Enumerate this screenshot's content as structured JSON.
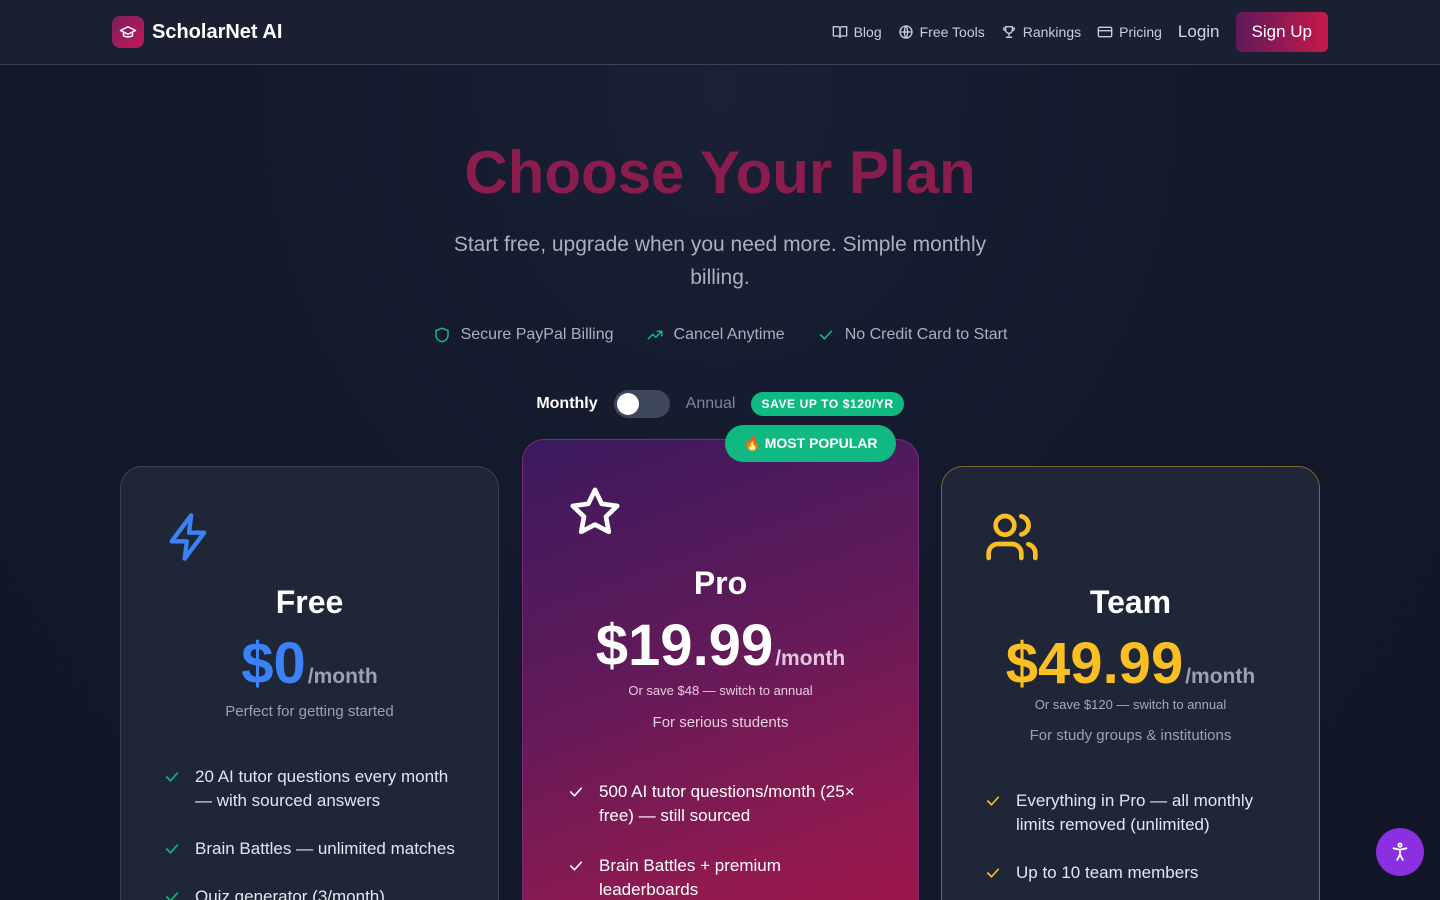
{
  "brand": {
    "name": "ScholarNet AI"
  },
  "nav": {
    "items": [
      {
        "label": "Blog",
        "icon": "book-icon"
      },
      {
        "label": "Free Tools",
        "icon": "globe-icon"
      },
      {
        "label": "Rankings",
        "icon": "trophy-icon"
      },
      {
        "label": "Pricing",
        "icon": "credit-card-icon"
      }
    ],
    "login": "Login",
    "signup": "Sign Up"
  },
  "hero": {
    "title": "Choose Your Plan",
    "subtitle": "Start free, upgrade when you need more. Simple monthly billing."
  },
  "trust": [
    {
      "label": "Secure PayPal Billing",
      "icon": "shield-icon"
    },
    {
      "label": "Cancel Anytime",
      "icon": "trending-up-icon"
    },
    {
      "label": "No Credit Card to Start",
      "icon": "check-icon"
    }
  ],
  "billing": {
    "monthly": "Monthly",
    "annual": "Annual",
    "save_badge": "SAVE UP TO $120/YR",
    "selected": "Monthly"
  },
  "plans": {
    "free": {
      "name": "Free",
      "price": "$0",
      "per": "/month",
      "tagline": "Perfect for getting started",
      "features": [
        "20 AI tutor questions every month — with sourced answers",
        "Brain Battles — unlimited matches",
        "Quiz generator (3/month)"
      ]
    },
    "pro": {
      "badge": "🔥 MOST POPULAR",
      "name": "Pro",
      "price": "$19.99",
      "per": "/month",
      "save_note": "Or save $48 — switch to annual",
      "tagline": "For serious students",
      "features": [
        "500 AI tutor questions/month (25× free) — still sourced",
        "Brain Battles + premium leaderboards"
      ]
    },
    "team": {
      "name": "Team",
      "price": "$49.99",
      "per": "/month",
      "save_note": "Or save $120 — switch to annual",
      "tagline": "For study groups & institutions",
      "features": [
        "Everything in Pro — all monthly limits removed (unlimited)",
        "Up to 10 team members"
      ]
    }
  },
  "colors": {
    "accent_pink": "#c8184a",
    "free_blue": "#3b82f6",
    "team_gold": "#fbbf24",
    "success_green": "#10b981"
  }
}
